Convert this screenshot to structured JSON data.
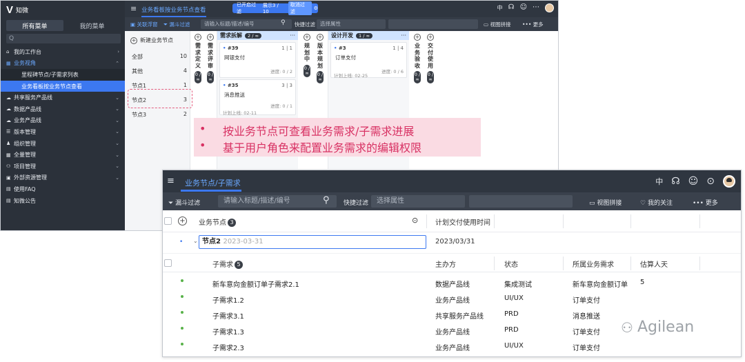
{
  "background_window": {
    "sidebar": {
      "logo_text": "知微",
      "tabs": [
        "所有菜单",
        "我的菜单"
      ],
      "search_placeholder": "Q",
      "items": [
        {
          "icon": "home-icon",
          "label": "我的工作台",
          "chevron": "›"
        },
        {
          "icon": "grid-icon",
          "label": "业务视角",
          "chevron": "⌃",
          "open": true
        },
        {
          "label": "里程碑节点/子需求列表",
          "sub": true
        },
        {
          "label": "业务看板按业务节点查看",
          "sub": true,
          "selected": true
        },
        {
          "icon": "cloud-icon",
          "label": "共享服务产品线",
          "chevron": "⌄"
        },
        {
          "icon": "cloud-icon",
          "label": "数据产品线",
          "chevron": "⌄"
        },
        {
          "icon": "cloud-icon",
          "label": "业务产品线",
          "chevron": "⌄"
        },
        {
          "icon": "list-icon",
          "label": "版本管理",
          "chevron": "⌄"
        },
        {
          "icon": "user-icon",
          "label": "组织管理",
          "chevron": "⌄"
        },
        {
          "icon": "grid-icon",
          "label": "全量管理",
          "chevron": "⌄"
        },
        {
          "icon": "tree-icon",
          "label": "项目管理",
          "chevron": "⌄"
        },
        {
          "icon": "box-icon",
          "label": "外部资源管理",
          "chevron": "⌄"
        },
        {
          "icon": "doc-icon",
          "label": "使用FAQ"
        },
        {
          "icon": "doc-icon",
          "label": "知微公告"
        }
      ]
    },
    "topbar": {
      "breadcrumb": "业务看板按业务节点查看",
      "filter_status": "已开启过滤",
      "filter_count": "展示3 / 10",
      "filter_cancel": "取消过滤",
      "lang": "中"
    },
    "toolbar": {
      "link_view": "关联浮窗",
      "funnel_filter": "漏斗过滤",
      "search_placeholder": "请输入标题/描述/编号",
      "quick_filter": "快捷过滤",
      "attr_placeholder": "选择属性",
      "view_tile": "视图拼接",
      "more": "••• 更多"
    },
    "node_panel": {
      "new_label": "新建业务节点",
      "rows": [
        {
          "name": "全部",
          "count": "10"
        },
        {
          "name": "其他",
          "count": "4"
        },
        {
          "name": "节点1",
          "count": "1"
        },
        {
          "name": "节点2",
          "count": "3"
        },
        {
          "name": "节点3",
          "count": "2"
        }
      ]
    },
    "vertical_columns": [
      {
        "label": [
          "需",
          "求",
          "定",
          "义"
        ],
        "count": "0 / ∞"
      },
      {
        "label": [
          "需",
          "求",
          "评",
          "审"
        ],
        "count": "0 / ∞"
      },
      {
        "label": [
          "规",
          "划",
          "中"
        ],
        "count": "0 / ∞"
      },
      {
        "label": [
          "版",
          "本",
          "规",
          "划"
        ],
        "count": "0 / ∞"
      },
      {
        "label": [
          "业",
          "务",
          "验",
          "收"
        ],
        "count": "0 / ∞"
      },
      {
        "label": [
          "交",
          "付",
          "使",
          "用"
        ],
        "count": "0 / ∞"
      }
    ],
    "columns": [
      {
        "title": "需求拆解",
        "wip": "2 / ∞",
        "cards": [
          {
            "id": "#39",
            "page": "1 | 1",
            "title": "网银支付",
            "progress": "进度: 0 / 2",
            "date": ""
          },
          {
            "id": "#35",
            "page": "3 | 3",
            "title": "消息推送",
            "progress": "进度: 0 / 1",
            "date": "计划上线: 02-11"
          }
        ]
      },
      {
        "title": "设计开发",
        "wip": "1 / ∞",
        "cards": [
          {
            "id": "#3",
            "page": "1 | 4",
            "title": "订单支付",
            "progress": "进度: 0 / 6",
            "date": "计划上线: 02-25"
          }
        ]
      }
    ],
    "more_glyph": "···",
    "callout": [
      "按业务节点可查看业务需求/子需求进展",
      "基于用户角色来配置业务需求的编辑权限"
    ]
  },
  "foreground_window": {
    "breadcrumb": "业务节点/子需求",
    "lang": "中",
    "toolbar": {
      "funnel_filter": "漏斗过滤",
      "search_placeholder": "请输入标题/描述/编号",
      "quick_filter": "快捷过滤",
      "attr_placeholder": "选择属性",
      "view_tile": "视图拼接",
      "follow": "我的关注",
      "more": "••• 更多"
    },
    "header1": {
      "node_label": "业务节点",
      "node_count": "3",
      "delivery_time": "计划交付使用时间"
    },
    "node_row": {
      "name": "节点2",
      "date_hint": "2023-03-31",
      "delivery_date": "2023/03/31"
    },
    "header2": {
      "sub_label": "子需求",
      "sub_count": "5",
      "owner": "主办方",
      "status": "状态",
      "parent": "所属业务需求",
      "estimate": "估算人天"
    },
    "rows": [
      {
        "name": "新车意向金额订单子需求2.1",
        "owner": "数据产品线",
        "status": "集成测试",
        "parent": "新车意向金额订单",
        "estimate": "5"
      },
      {
        "name": "子需求1.2",
        "owner": "业务产品线",
        "status": "UI/UX",
        "parent": "订单支付",
        "estimate": ""
      },
      {
        "name": "子需求3.1",
        "owner": "共享服务产品线",
        "status": "PRD",
        "parent": "消息推送",
        "estimate": ""
      },
      {
        "name": "子需求1.3",
        "owner": "业务产品线",
        "status": "PRD",
        "parent": "订单支付",
        "estimate": ""
      },
      {
        "name": "子需求2.3",
        "owner": "业务产品线",
        "status": "UI/UX",
        "parent": "订单支付",
        "estimate": ""
      }
    ]
  },
  "watermark": "Agilean",
  "colors": {
    "accent": "#3c78f0",
    "dark": "#2f3640",
    "callout_bg": "#fadbe3",
    "callout_text": "#d83163"
  }
}
